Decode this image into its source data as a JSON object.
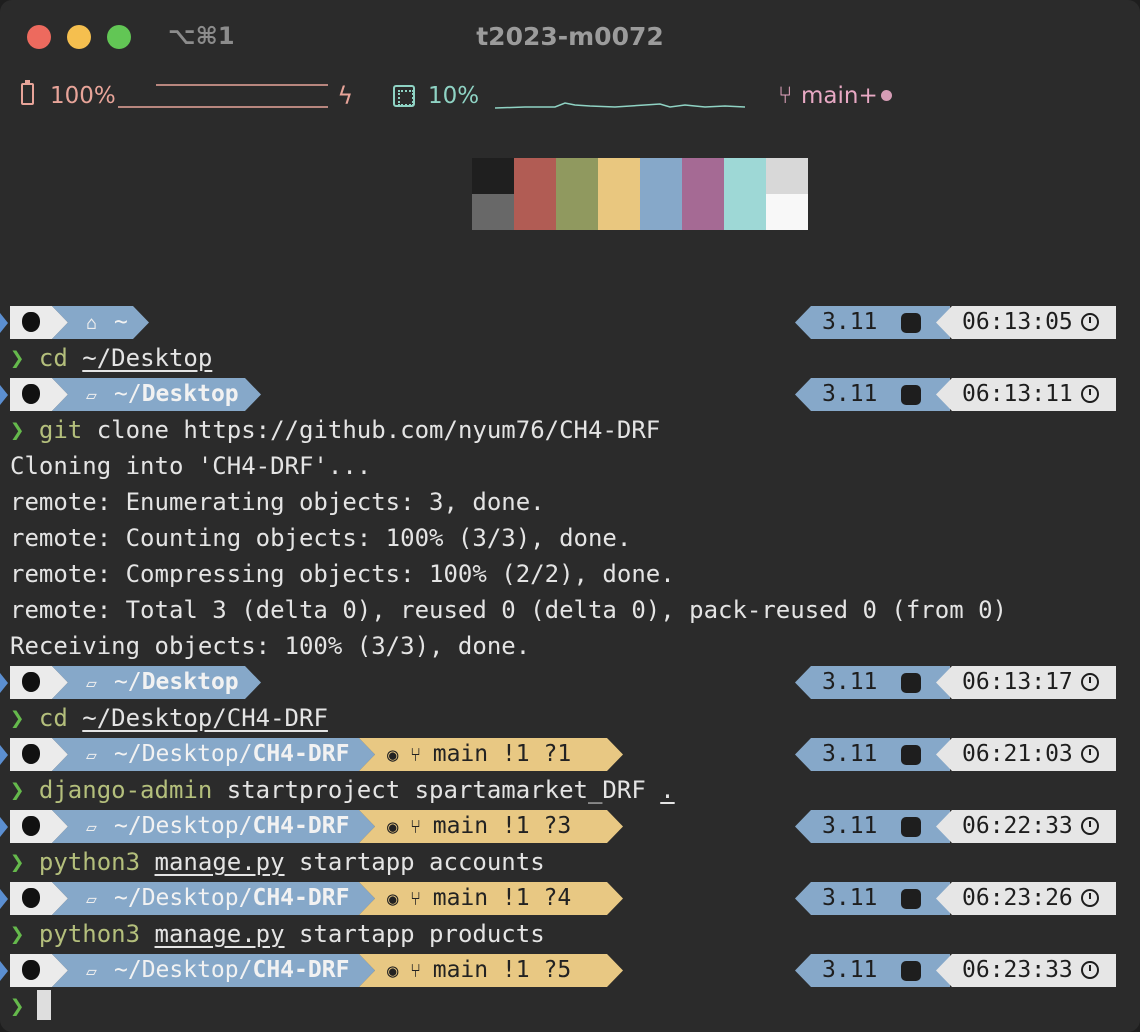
{
  "window": {
    "title": "t2023-m0072",
    "tab_shortcut": "⌥⌘1"
  },
  "status_bar": {
    "battery": {
      "icon": "battery-icon",
      "percent_text": "100%",
      "level": 1.0
    },
    "bolt_icon": "bolt-icon",
    "cpu": {
      "icon": "cpu-icon",
      "percent_text": "10%",
      "level": 0.1
    },
    "git": {
      "icon": "git-branch-icon",
      "branch_text": "main",
      "dirty_marker": "+"
    }
  },
  "palette": {
    "top": [
      "#1f1f1f",
      "#b15c54",
      "#90995f",
      "#e9c77f",
      "#86a8c9",
      "#a56a94",
      "#9ed8d6",
      "#d8d8d8"
    ],
    "bottom": [
      "#686868",
      "#b15c54",
      "#90995f",
      "#e9c77f",
      "#86a8c9",
      "#a56a94",
      "#9ed8d6",
      "#f8f8f8"
    ]
  },
  "colors": {
    "prompt_green": "#65b94c",
    "command_olive": "#b4bf7c",
    "dir_blue": "#86a8c9",
    "git_yellow": "#e8c883",
    "time_gray": "#e6e6e6"
  },
  "prompts": [
    {
      "dir_prefix": "~",
      "dir_main": "",
      "home": true,
      "git": null,
      "python": "3.11",
      "time": "06:13:05"
    },
    {
      "dir_prefix": "~/",
      "dir_main": "Desktop",
      "home": false,
      "git": null,
      "python": "3.11",
      "time": "06:13:11"
    },
    {
      "dir_prefix": "~/",
      "dir_main": "Desktop",
      "home": false,
      "git": null,
      "python": "3.11",
      "time": "06:13:17"
    },
    {
      "dir_prefix": "~/Desktop/",
      "dir_main": "CH4-DRF",
      "home": false,
      "git": "main !1 ?1",
      "python": "3.11",
      "time": "06:21:03"
    },
    {
      "dir_prefix": "~/Desktop/",
      "dir_main": "CH4-DRF",
      "home": false,
      "git": "main !1 ?3",
      "python": "3.11",
      "time": "06:22:33"
    },
    {
      "dir_prefix": "~/Desktop/",
      "dir_main": "CH4-DRF",
      "home": false,
      "git": "main !1 ?4",
      "python": "3.11",
      "time": "06:23:26"
    },
    {
      "dir_prefix": "~/Desktop/",
      "dir_main": "CH4-DRF",
      "home": false,
      "git": "main !1 ?5",
      "python": "3.11",
      "time": "06:23:33"
    }
  ],
  "commands": [
    {
      "prompt": "❯",
      "name": "cd",
      "args": "~/Desktop"
    },
    {
      "prompt": "❯",
      "name": "git",
      "args": "clone https://github.com/nyum76/CH4-DRF"
    },
    {
      "prompt": "❯",
      "name": "cd",
      "args": "~/Desktop/CH4-DRF"
    },
    {
      "prompt": "❯",
      "name": "django-admin",
      "args_a": "startproject spartamarket_DRF",
      "args_b": "."
    },
    {
      "prompt": "❯",
      "name": "python3",
      "args_a": "manage.py",
      "args_b": "startapp accounts"
    },
    {
      "prompt": "❯",
      "name": "python3",
      "args_a": "manage.py",
      "args_b": "startapp products"
    },
    {
      "prompt": "❯"
    }
  ],
  "output": [
    "Cloning into 'CH4-DRF'...",
    "remote: Enumerating objects: 3, done.",
    "remote: Counting objects: 100% (3/3), done.",
    "remote: Compressing objects: 100% (2/2), done.",
    "remote: Total 3 (delta 0), reused 0 (delta 0), pack-reused 0 (from 0)",
    "Receiving objects: 100% (3/3), done."
  ]
}
